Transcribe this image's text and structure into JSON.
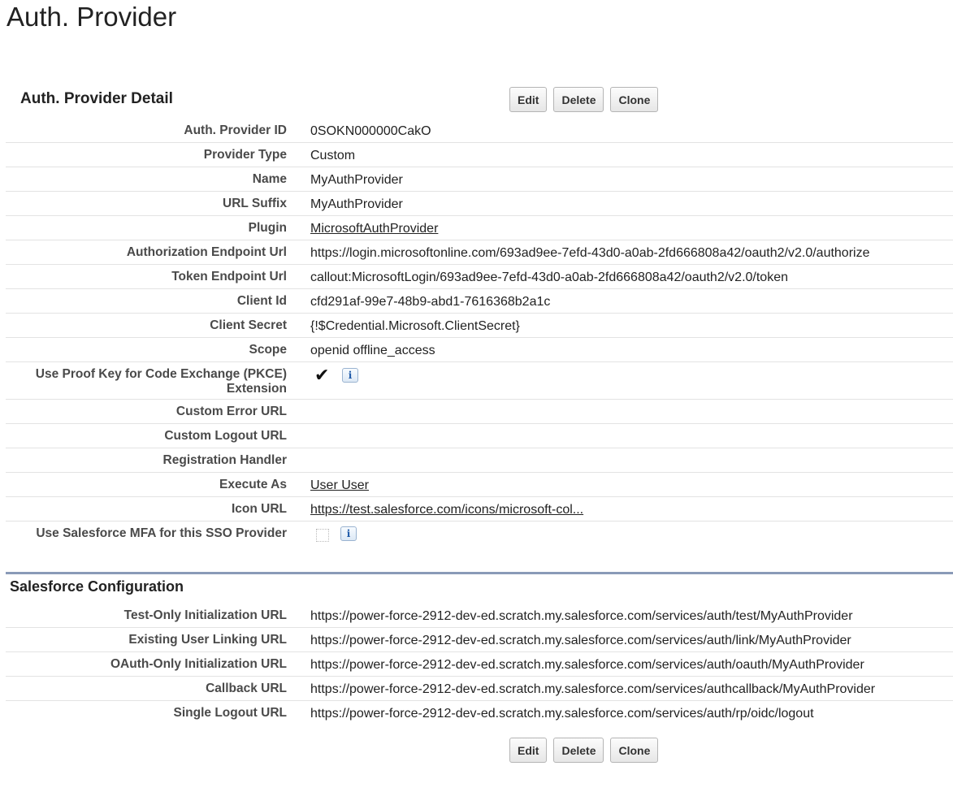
{
  "page": {
    "title": "Auth. Provider"
  },
  "detail": {
    "header": "Auth. Provider Detail",
    "buttons": {
      "edit": "Edit",
      "delete": "Delete",
      "clone": "Clone"
    },
    "fields": {
      "auth_provider_id": {
        "label": "Auth. Provider ID",
        "value": "0SOKN000000CakO"
      },
      "provider_type": {
        "label": "Provider Type",
        "value": "Custom"
      },
      "name": {
        "label": "Name",
        "value": "MyAuthProvider"
      },
      "url_suffix": {
        "label": "URL Suffix",
        "value": "MyAuthProvider"
      },
      "plugin": {
        "label": "Plugin",
        "value": "MicrosoftAuthProvider"
      },
      "authorization_endpoint": {
        "label": "Authorization Endpoint Url",
        "value": "https://login.microsoftonline.com/693ad9ee-7efd-43d0-a0ab-2fd666808a42/oauth2/v2.0/authorize"
      },
      "token_endpoint": {
        "label": "Token Endpoint Url",
        "value": "callout:MicrosoftLogin/693ad9ee-7efd-43d0-a0ab-2fd666808a42/oauth2/v2.0/token"
      },
      "client_id": {
        "label": "Client Id",
        "value": "cfd291af-99e7-48b9-abd1-7616368b2a1c"
      },
      "client_secret": {
        "label": "Client Secret",
        "value": "{!$Credential.Microsoft.ClientSecret}"
      },
      "scope": {
        "label": "Scope",
        "value": "openid offline_access"
      },
      "pkce": {
        "label_line1": "Use Proof Key for Code Exchange (PKCE)",
        "label_line2": "Extension",
        "checked": true,
        "check_glyph": "✔",
        "info_glyph": "i"
      },
      "custom_error_url": {
        "label": "Custom Error URL",
        "value": ""
      },
      "custom_logout_url": {
        "label": "Custom Logout URL",
        "value": ""
      },
      "registration_handler": {
        "label": "Registration Handler",
        "value": ""
      },
      "execute_as": {
        "label": "Execute As",
        "value": "User User"
      },
      "icon_url": {
        "label": "Icon URL",
        "value": "https://test.salesforce.com/icons/microsoft-col..."
      },
      "mfa": {
        "label": "Use Salesforce MFA for this SSO Provider",
        "checked": false,
        "info_glyph": "i"
      }
    }
  },
  "config": {
    "header": "Salesforce Configuration",
    "fields": {
      "test_only_init": {
        "label": "Test-Only Initialization URL",
        "value": "https://power-force-2912-dev-ed.scratch.my.salesforce.com/services/auth/test/MyAuthProvider"
      },
      "existing_user_linking": {
        "label": "Existing User Linking URL",
        "value": "https://power-force-2912-dev-ed.scratch.my.salesforce.com/services/auth/link/MyAuthProvider"
      },
      "oauth_only_init": {
        "label": "OAuth-Only Initialization URL",
        "value": "https://power-force-2912-dev-ed.scratch.my.salesforce.com/services/auth/oauth/MyAuthProvider"
      },
      "callback": {
        "label": "Callback URL",
        "value": "https://power-force-2912-dev-ed.scratch.my.salesforce.com/services/authcallback/MyAuthProvider"
      },
      "single_logout": {
        "label": "Single Logout URL",
        "value": "https://power-force-2912-dev-ed.scratch.my.salesforce.com/services/auth/rp/oidc/logout"
      }
    }
  },
  "bottom_buttons": {
    "edit": "Edit",
    "delete": "Delete",
    "clone": "Clone"
  },
  "colors": {
    "section_divider": "#8a9ab8",
    "info_icon": "#1f5aa8"
  }
}
